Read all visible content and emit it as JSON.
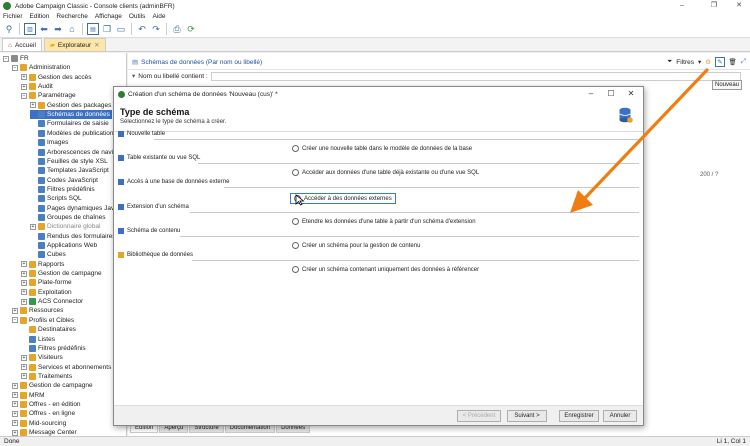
{
  "window": {
    "title": "Adobe Campaign Classic - Console clients (adminBFR)",
    "controls": [
      "–",
      "❐",
      "✕"
    ]
  },
  "menu": [
    "Fichier",
    "Edition",
    "Recherche",
    "Affichage",
    "Outils",
    "Aide"
  ],
  "tabs": [
    {
      "label": "Accueil"
    },
    {
      "label": "Explorateur"
    }
  ],
  "tree": {
    "items": [
      {
        "label": "FR",
        "indent": 0,
        "exp": "−",
        "color": "#8a8a8a"
      },
      {
        "label": "Administration",
        "indent": 1,
        "exp": "−",
        "color": "#e5a52b"
      },
      {
        "label": "Gestion des accès",
        "indent": 2,
        "exp": "+",
        "color": "#e5a52b"
      },
      {
        "label": "Audit",
        "indent": 2,
        "exp": "+",
        "color": "#e5a52b"
      },
      {
        "label": "Paramétrage",
        "indent": 2,
        "exp": "−",
        "color": "#e5a52b"
      },
      {
        "label": "Gestion des packages",
        "indent": 3,
        "exp": "+",
        "color": "#e5a52b"
      },
      {
        "label": "Schémas de données",
        "indent": 3,
        "exp": "",
        "color": "#4a7fc1",
        "selected": true
      },
      {
        "label": "Formulaires de saisie",
        "indent": 3,
        "exp": "",
        "color": "#4a7fc1"
      },
      {
        "label": "Modèles de publication",
        "indent": 3,
        "exp": "",
        "color": "#4a7fc1"
      },
      {
        "label": "Images",
        "indent": 3,
        "exp": "",
        "color": "#4a7fc1"
      },
      {
        "label": "Arborescences de navigation",
        "indent": 3,
        "exp": "",
        "color": "#4a7fc1"
      },
      {
        "label": "Feuilles de style XSL",
        "indent": 3,
        "exp": "",
        "color": "#4a7fc1"
      },
      {
        "label": "Templates JavaScript",
        "indent": 3,
        "exp": "",
        "color": "#4a7fc1"
      },
      {
        "label": "Codes JavaScript",
        "indent": 3,
        "exp": "",
        "color": "#4a7fc1"
      },
      {
        "label": "Filtres prédéfinis",
        "indent": 3,
        "exp": "",
        "color": "#4a7fc1"
      },
      {
        "label": "Scripts SQL",
        "indent": 3,
        "exp": "",
        "color": "#4a7fc1"
      },
      {
        "label": "Pages dynamiques JavaScript",
        "indent": 3,
        "exp": "",
        "color": "#4a7fc1"
      },
      {
        "label": "Groupes de chaînes",
        "indent": 3,
        "exp": "",
        "color": "#4a7fc1"
      },
      {
        "label": "Dictionnaire global",
        "indent": 3,
        "exp": "+",
        "color": "#e5a52b",
        "muted": true
      },
      {
        "label": "Rendus des formulaires",
        "indent": 3,
        "exp": "",
        "color": "#4a7fc1"
      },
      {
        "label": "Applications Web",
        "indent": 3,
        "exp": "",
        "color": "#4a7fc1"
      },
      {
        "label": "Cubes",
        "indent": 3,
        "exp": "",
        "color": "#4a7fc1"
      },
      {
        "label": "Rapports",
        "indent": 2,
        "exp": "+",
        "color": "#e5a52b"
      },
      {
        "label": "Gestion de campagne",
        "indent": 2,
        "exp": "+",
        "color": "#e5a52b"
      },
      {
        "label": "Plate-forme",
        "indent": 2,
        "exp": "+",
        "color": "#e5a52b"
      },
      {
        "label": "Exploitation",
        "indent": 2,
        "exp": "+",
        "color": "#e5a52b"
      },
      {
        "label": "ACS Connector",
        "indent": 2,
        "exp": "+",
        "color": "#2e9e49"
      },
      {
        "label": "Ressources",
        "indent": 1,
        "exp": "+",
        "color": "#e5a52b"
      },
      {
        "label": "Profils et Cibles",
        "indent": 1,
        "exp": "−",
        "color": "#e5a52b"
      },
      {
        "label": "Destinataires",
        "indent": 2,
        "exp": "",
        "color": "#e5a52b"
      },
      {
        "label": "Listes",
        "indent": 2,
        "exp": "",
        "color": "#4a7fc1"
      },
      {
        "label": "Filtres prédéfinis",
        "indent": 2,
        "exp": "",
        "color": "#4a7fc1"
      },
      {
        "label": "Visiteurs",
        "indent": 2,
        "exp": "+",
        "color": "#e5a52b"
      },
      {
        "label": "Services et abonnements",
        "indent": 2,
        "exp": "+",
        "color": "#e5a52b"
      },
      {
        "label": "Traitements",
        "indent": 2,
        "exp": "+",
        "color": "#e5a52b"
      },
      {
        "label": "Gestion de campagne",
        "indent": 1,
        "exp": "+",
        "color": "#e5a52b"
      },
      {
        "label": "MRM",
        "indent": 1,
        "exp": "+",
        "color": "#e5a52b"
      },
      {
        "label": "Offres - en édition",
        "indent": 1,
        "exp": "+",
        "color": "#e5a52b"
      },
      {
        "label": "Offres - en ligne",
        "indent": 1,
        "exp": "+",
        "color": "#e5a52b"
      },
      {
        "label": "Mid-sourcing",
        "indent": 1,
        "exp": "+",
        "color": "#e5a52b"
      },
      {
        "label": "Message Center",
        "indent": 1,
        "exp": "+",
        "color": "#e5a52b"
      }
    ]
  },
  "rightpane": {
    "header": "Schémas de données (Par nom ou libellé)",
    "filter_label": "Nom ou libellé contient :",
    "filters_label": "Filtres",
    "tooltip": "Nouveau",
    "count": "200 / ?"
  },
  "dialog": {
    "title": "Création d'un schéma de données 'Nouveau (cus)' *",
    "heading": "Type de schéma",
    "subtitle": "Sélectionnez le type de schéma à créer.",
    "categories": [
      {
        "label": "Nouvelle table",
        "option": "Créer une nouvelle table dans le modèle de données de la base"
      },
      {
        "label": "Table existante ou vue SQL",
        "option": "Accéder aux données d'une table déjà existante ou d'une vue SQL"
      },
      {
        "label": "Accès à une base de données externe",
        "option": "Accéder à des données externes",
        "selected": true
      },
      {
        "label": "Extension d'un schéma",
        "option": "Etendre les données d'une table à partir d'un schéma d'extension"
      },
      {
        "label": "Schéma de contenu",
        "option": "Créer un schéma pour la gestion de contenu"
      },
      {
        "label": "Bibliothèque de données",
        "option": "Créer un schéma contenant uniquement des données à référencer"
      }
    ],
    "buttons": {
      "prev": "< Précédent",
      "next": "Suivant >",
      "save": "Enregistrer",
      "cancel": "Annuler"
    }
  },
  "bottom_tabs": [
    "Edition",
    "Aperçu",
    "Structure",
    "Documentation",
    "Données"
  ],
  "status": {
    "left": "Done",
    "right": "Li 1, Col 1"
  },
  "colors": {
    "accent": "#3b70c4",
    "arrow": "#f07d12"
  }
}
